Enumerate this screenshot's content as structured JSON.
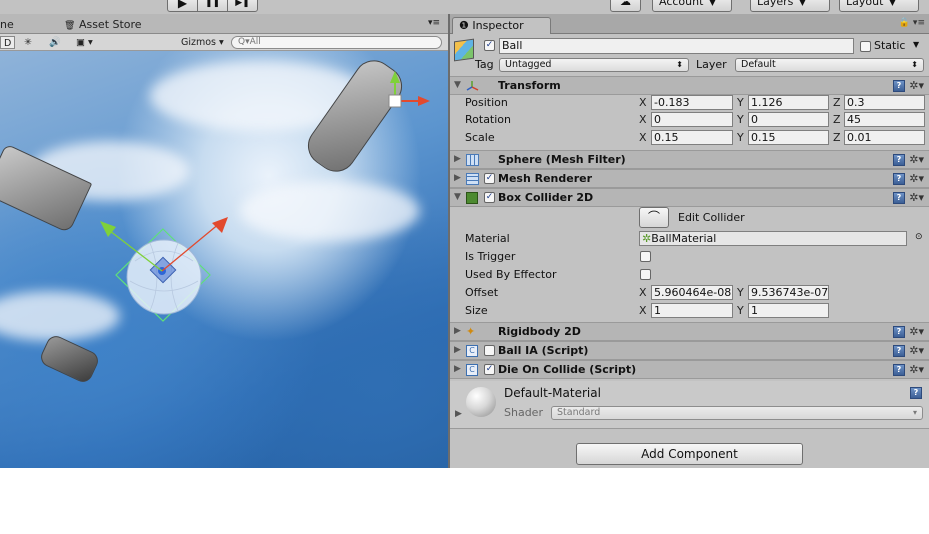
{
  "toolbar": {
    "play_icon": "▶",
    "pause_icon": "❚❚",
    "step_icon": "▶❚",
    "cloud_icon": "☁",
    "account_label": "Account",
    "layers_label": "Layers",
    "layout_label": "Layout"
  },
  "scene": {
    "tab_left_fragment": "ne",
    "tab_asset_store": "Asset Store",
    "mode_2d": "D",
    "gizmos_label": "Gizmos",
    "search_placeholder": "All"
  },
  "inspector": {
    "tab_label": "Inspector",
    "object_name": "Ball",
    "static_label": "Static",
    "tag_label": "Tag",
    "tag_value": "Untagged",
    "layer_label": "Layer",
    "layer_value": "Default",
    "transform": {
      "title": "Transform",
      "position_label": "Position",
      "rotation_label": "Rotation",
      "scale_label": "Scale",
      "position": {
        "x": "-0.183",
        "y": "1.126",
        "z": "0.3"
      },
      "rotation": {
        "x": "0",
        "y": "0",
        "z": "45"
      },
      "scale": {
        "x": "0.15",
        "y": "0.15",
        "z": "0.01"
      }
    },
    "components": {
      "mesh_filter": "Sphere (Mesh Filter)",
      "mesh_renderer": "Mesh Renderer",
      "box_collider": "Box Collider 2D",
      "rigidbody": "Rigidbody 2D",
      "ball_ia": "Ball IA (Script)",
      "die_on_collide": "Die On Collide (Script)"
    },
    "box_collider": {
      "edit_collider_label": "Edit Collider",
      "material_label": "Material",
      "material_value": "BallMaterial",
      "is_trigger_label": "Is Trigger",
      "used_by_effector_label": "Used By Effector",
      "offset_label": "Offset",
      "offset": {
        "x": "5.960464e-08",
        "y": "9.536743e-07"
      },
      "size_label": "Size",
      "size": {
        "x": "1",
        "y": "1"
      }
    },
    "material": {
      "name": "Default-Material",
      "shader_label": "Shader",
      "shader_value": "Standard"
    },
    "add_component_label": "Add Component"
  },
  "axes": {
    "x": "X",
    "y": "Y",
    "z": "Z"
  },
  "colors": {
    "panel_bg": "#c2c2c2",
    "header_bg": "#b5b5b5",
    "help_icon": "#4a6fa8",
    "gizmo_red": "#e24a2e",
    "gizmo_green": "#7fd13a",
    "collider_green": "#5fe07a"
  }
}
